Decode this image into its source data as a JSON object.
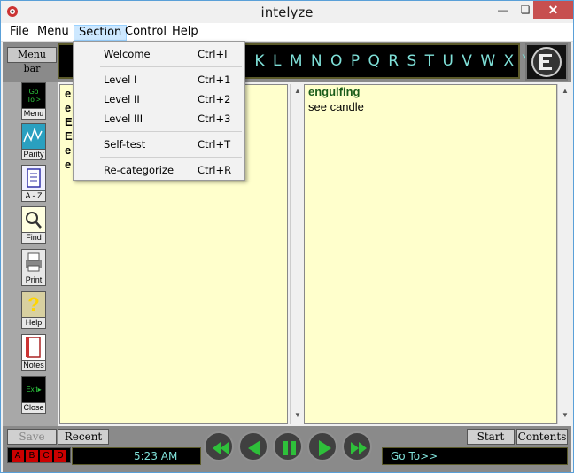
{
  "window": {
    "title": "intelyze"
  },
  "menubar": {
    "file": "File",
    "menu": "Menu",
    "section": "Section",
    "control": "Control",
    "help": "Help"
  },
  "section_menu": [
    {
      "label": "Welcome",
      "shortcut": "Ctrl+I"
    },
    {
      "label": "Level I",
      "shortcut": "Ctrl+1"
    },
    {
      "label": "Level II",
      "shortcut": "Ctrl+2"
    },
    {
      "label": "Level III",
      "shortcut": "Ctrl+3"
    },
    {
      "label": "Self-test",
      "shortcut": "Ctrl+T"
    },
    {
      "label": "Re-categorize",
      "shortcut": "Ctrl+R"
    }
  ],
  "toolbar": {
    "menu_bar_button": "Menu bar",
    "alphabet": "J K L M N O P Q R S T U V W X Y Z"
  },
  "tools": [
    {
      "icon": "goto-icon",
      "label": "Menu"
    },
    {
      "icon": "parity-icon",
      "label": "Parity"
    },
    {
      "icon": "dictionary-icon",
      "label": "A - Z"
    },
    {
      "icon": "magnifier-icon",
      "label": "Find"
    },
    {
      "icon": "printer-icon",
      "label": "Print"
    },
    {
      "icon": "question-icon",
      "label": "Help"
    },
    {
      "icon": "notes-icon",
      "label": "Notes"
    },
    {
      "icon": "exit-icon",
      "label": "Close"
    }
  ],
  "left_list": [
    "e",
    "e",
    "E",
    "E",
    "e",
    "e"
  ],
  "entry": {
    "term": "engulfing",
    "definition": "see candle"
  },
  "bottom": {
    "save": "Save",
    "recent": "Recent",
    "start": "Start",
    "contents": "Contents",
    "abcd": [
      "A",
      "B",
      "C",
      "D"
    ],
    "clock": "5:23 AM",
    "goto": "Go To>>"
  },
  "colors": {
    "pane_bg": "#ffffcc",
    "term_color": "#1a5c1a",
    "lcd_text": "#7fe0d8",
    "abcd_red": "#cc0000"
  }
}
